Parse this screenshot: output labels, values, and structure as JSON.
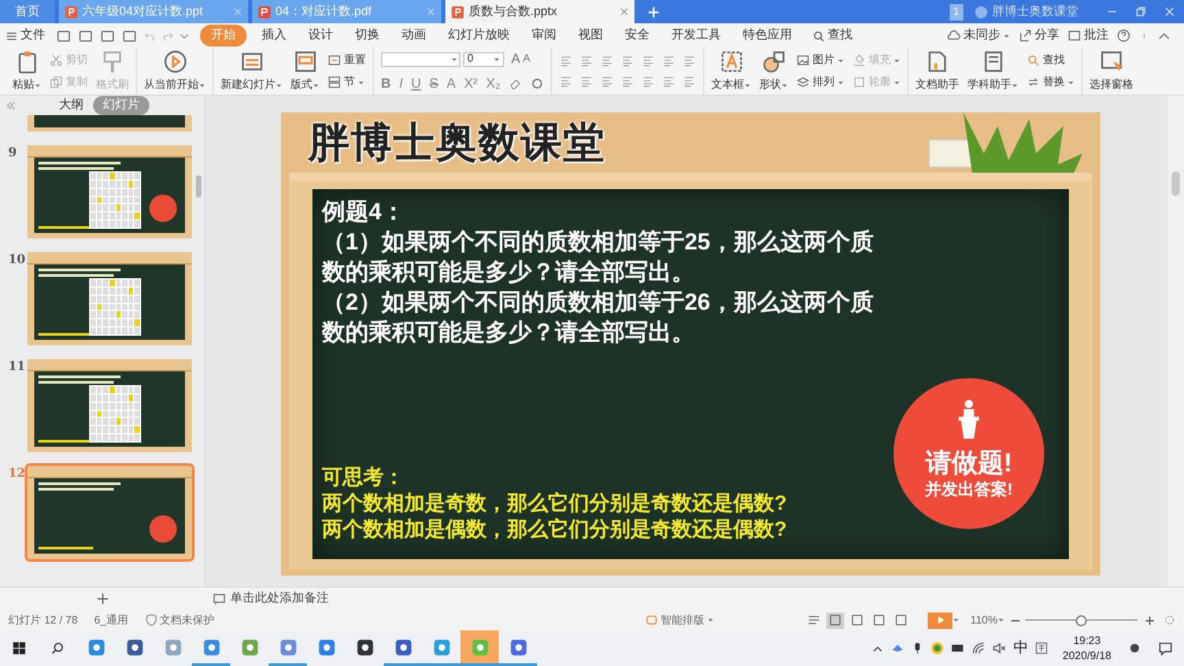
{
  "window": {
    "tabs": [
      {
        "label": "首页",
        "kind": "home",
        "selected": false
      },
      {
        "label": "六年级04对应计数.ppt",
        "kind": "ppt",
        "selected": false
      },
      {
        "label": "04：对应计数.pdf",
        "kind": "pdf",
        "selected": false
      },
      {
        "label": "质数与合数.pptx",
        "kind": "ppt",
        "selected": true
      }
    ],
    "badge": "1",
    "account": "胖博士奥数课堂"
  },
  "menu": {
    "file": "文件",
    "items": [
      {
        "label": "开始",
        "selected": true
      },
      {
        "label": "插入",
        "selected": false
      },
      {
        "label": "设计",
        "selected": false
      },
      {
        "label": "切换",
        "selected": false
      },
      {
        "label": "动画",
        "selected": false
      },
      {
        "label": "幻灯片放映",
        "selected": false
      },
      {
        "label": "审阅",
        "selected": false
      },
      {
        "label": "视图",
        "selected": false
      },
      {
        "label": "安全",
        "selected": false
      },
      {
        "label": "开发工具",
        "selected": false
      },
      {
        "label": "特色应用",
        "selected": false
      }
    ],
    "search": "查找",
    "actions": [
      {
        "label": "未同步",
        "dropdown": true
      },
      {
        "label": "分享",
        "dropdown": false
      },
      {
        "label": "批注",
        "dropdown": false
      }
    ]
  },
  "ribbon": {
    "groups": [
      {
        "kind": "buttons",
        "items": [
          {
            "kind": "large",
            "label": "粘贴",
            "dropdown": true,
            "disabled": false
          },
          {
            "kind": "stack",
            "items": [
              {
                "label": "剪切",
                "dropdown": false,
                "disabled": true
              },
              {
                "label": "复制",
                "dropdown": false,
                "disabled": true
              }
            ]
          },
          {
            "kind": "large",
            "label": "格式刷",
            "dropdown": false,
            "disabled": true
          }
        ]
      },
      {
        "kind": "buttons",
        "items": [
          {
            "kind": "large",
            "label": "从当前开始",
            "dropdown": true,
            "disabled": false
          }
        ]
      },
      {
        "kind": "buttons",
        "items": [
          {
            "kind": "large",
            "label": "新建幻灯片",
            "dropdown": true,
            "disabled": false
          },
          {
            "kind": "large",
            "label": "版式",
            "dropdown": true,
            "disabled": false
          },
          {
            "kind": "stack",
            "items": [
              {
                "label": "重置",
                "dropdown": false,
                "disabled": false
              },
              {
                "label": "节",
                "dropdown": true,
                "disabled": false
              }
            ]
          }
        ]
      },
      {
        "kind": "font",
        "size": "0",
        "grow": "A",
        "shrink": "A",
        "buttons": [
          "B",
          "I",
          "U",
          "S",
          "A",
          "X²",
          "X₂"
        ]
      },
      {
        "kind": "paragraph"
      },
      {
        "kind": "buttons",
        "items": [
          {
            "kind": "large",
            "label": "文本框",
            "dropdown": true,
            "disabled": false
          },
          {
            "kind": "large",
            "label": "形状",
            "dropdown": true,
            "disabled": false
          },
          {
            "kind": "stack",
            "items": [
              {
                "label": "图片",
                "dropdown": true,
                "disabled": false
              },
              {
                "label": "排列",
                "dropdown": true,
                "disabled": false
              }
            ]
          },
          {
            "kind": "stack",
            "items": [
              {
                "label": "填充",
                "dropdown": true,
                "disabled": true
              },
              {
                "label": "轮廓",
                "dropdown": true,
                "disabled": true
              }
            ]
          }
        ]
      },
      {
        "kind": "buttons",
        "items": [
          {
            "kind": "large",
            "label": "文档助手",
            "dropdown": false,
            "disabled": false
          },
          {
            "kind": "large",
            "label": "学科助手",
            "dropdown": true,
            "disabled": false
          },
          {
            "kind": "stack",
            "items": [
              {
                "label": "查找",
                "dropdown": false,
                "disabled": false
              },
              {
                "label": "替换",
                "dropdown": true,
                "disabled": false
              }
            ]
          }
        ]
      },
      {
        "kind": "buttons",
        "items": [
          {
            "kind": "large",
            "label": "选择窗格",
            "dropdown": false,
            "disabled": false
          }
        ]
      }
    ]
  },
  "left_panel": {
    "views": [
      {
        "label": "大纲",
        "selected": false
      },
      {
        "label": "幻灯片",
        "selected": true
      }
    ],
    "thumbnails": [
      {
        "kind": "cut",
        "selected": false
      },
      {
        "number": "9",
        "kind": "grid-stamp",
        "selected": false
      },
      {
        "number": "10",
        "kind": "grid",
        "selected": false
      },
      {
        "number": "11",
        "kind": "grid",
        "selected": false
      },
      {
        "number": "12",
        "kind": "stamp",
        "selected": true
      }
    ]
  },
  "slide": {
    "title": "胖博士奥数课堂",
    "heading": "例题4：",
    "questions": [
      "（1）如果两个不同的质数相加等于25，那么这两个质数的乘积可能是多少？请全部写出。",
      "（2）如果两个不同的质数相加等于26，那么这两个质数的乘积可能是多少？请全部写出。"
    ],
    "stamp": {
      "title": "请做题!",
      "subtitle": "并发出答案!"
    },
    "think": {
      "heading": "可思考：",
      "lines": [
        "两个数相加是奇数，那么它们分别是奇数还是偶数?",
        "两个数相加是偶数，那么它们分别是奇数还是偶数?"
      ]
    }
  },
  "notes": {
    "hint": "单击此处添加备注"
  },
  "status_bar": {
    "slide": "幻灯片 12 / 78",
    "theme": "6_通用",
    "protection": "文档未保护",
    "smart_layout": "智能排版",
    "views": [
      {
        "selected": true
      },
      {
        "selected": false
      },
      {
        "selected": false
      },
      {
        "selected": false
      }
    ],
    "zoom": "110%",
    "zoom_slider": {
      "level": 0.5
    }
  },
  "taskbar": {
    "apps": [
      {
        "running": false,
        "selected": false
      },
      {
        "running": false,
        "selected": false
      },
      {
        "running": false,
        "selected": false
      },
      {
        "running": true,
        "selected": false
      },
      {
        "running": false,
        "selected": false
      },
      {
        "running": true,
        "selected": false
      },
      {
        "running": false,
        "selected": false
      },
      {
        "running": false,
        "selected": false
      },
      {
        "running": true,
        "selected": false
      },
      {
        "running": true,
        "selected": false
      },
      {
        "running": true,
        "selected": true
      },
      {
        "running": true,
        "selected": false
      }
    ],
    "ime": "中",
    "time": "19:23",
    "date": "2020/9/18"
  }
}
